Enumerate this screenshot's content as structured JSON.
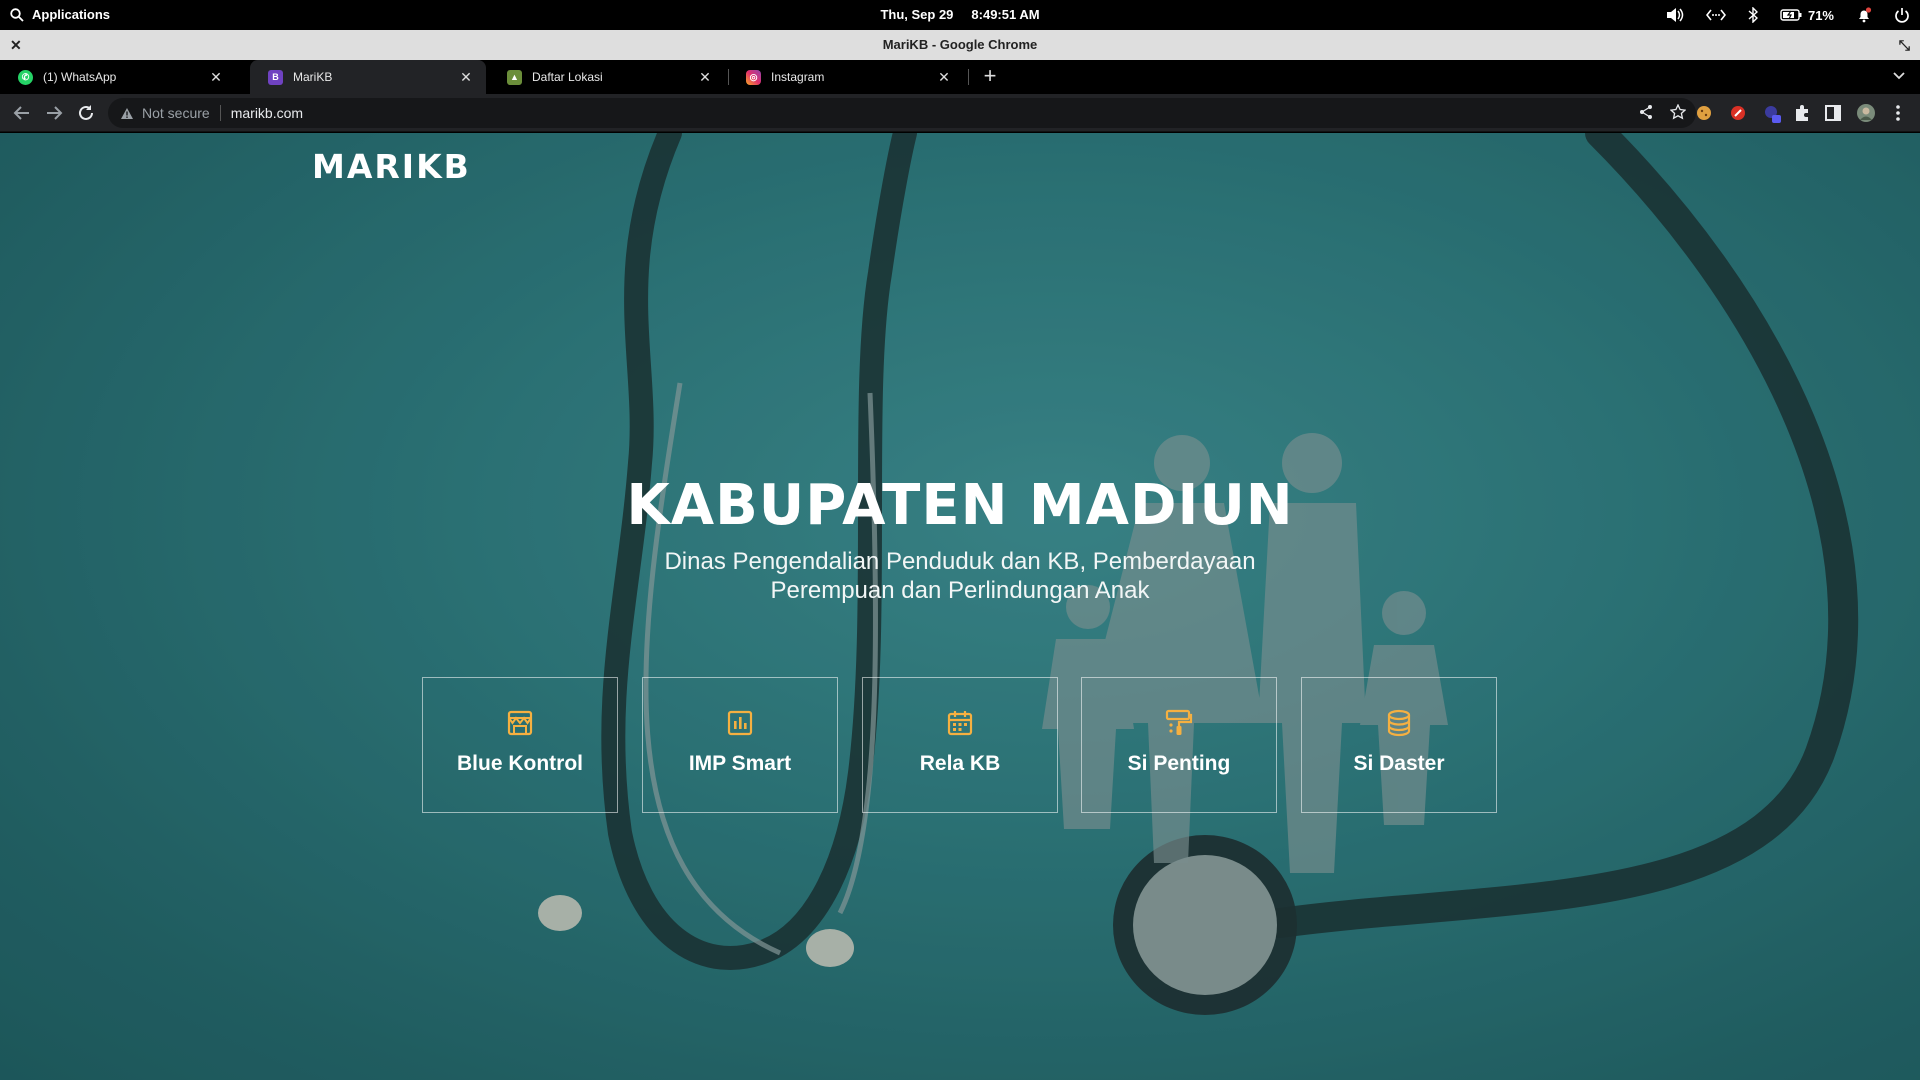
{
  "system_bar": {
    "apps_label": "Applications",
    "date": "Thu, Sep 29",
    "time": "8:49:51 AM",
    "battery": "71%"
  },
  "window": {
    "title": "MariKB - Google Chrome"
  },
  "tabs": [
    {
      "label": "(1) WhatsApp",
      "icon": "whatsapp-icon",
      "color": "#25d366"
    },
    {
      "label": "MariKB",
      "icon": "bootstrap-icon",
      "color": "#6f42c1"
    },
    {
      "label": "Daftar Lokasi",
      "icon": "emblem-icon",
      "color": "#6b8e3a"
    },
    {
      "label": "Instagram",
      "icon": "instagram-icon",
      "color": "#e1306c"
    }
  ],
  "omnibox": {
    "security_label": "Not secure",
    "url": "marikb.com"
  },
  "page": {
    "brand": "MARIKB",
    "title": "KABUPATEN MADIUN",
    "subtitle": "Dinas Pengendalian Penduduk dan KB, Pemberdayaan Perempuan dan Perlindungan Anak",
    "accent_color": "#f5b041",
    "cards": [
      {
        "label": "Blue Kontrol",
        "icon": "shop-window-icon"
      },
      {
        "label": "IMP Smart",
        "icon": "bar-chart-icon"
      },
      {
        "label": "Rela KB",
        "icon": "calendar-icon"
      },
      {
        "label": "Si Penting",
        "icon": "paint-roller-icon"
      },
      {
        "label": "Si Daster",
        "icon": "database-icon"
      }
    ]
  }
}
